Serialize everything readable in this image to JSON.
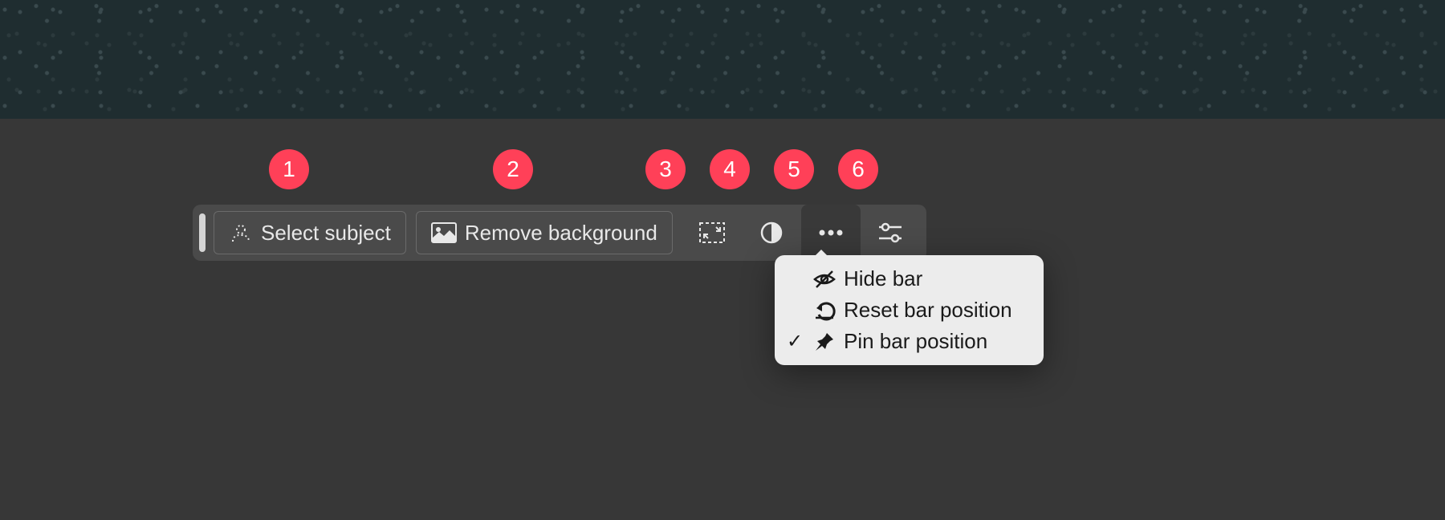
{
  "toolbar": {
    "select_subject_label": "Select subject",
    "remove_background_label": "Remove background"
  },
  "badges": {
    "b1": "1",
    "b2": "2",
    "b3": "3",
    "b4": "4",
    "b5": "5",
    "b6": "6"
  },
  "dropdown": {
    "hide_bar": "Hide bar",
    "reset_bar_position": "Reset bar position",
    "pin_bar_position": "Pin bar position",
    "pin_checked": true
  }
}
